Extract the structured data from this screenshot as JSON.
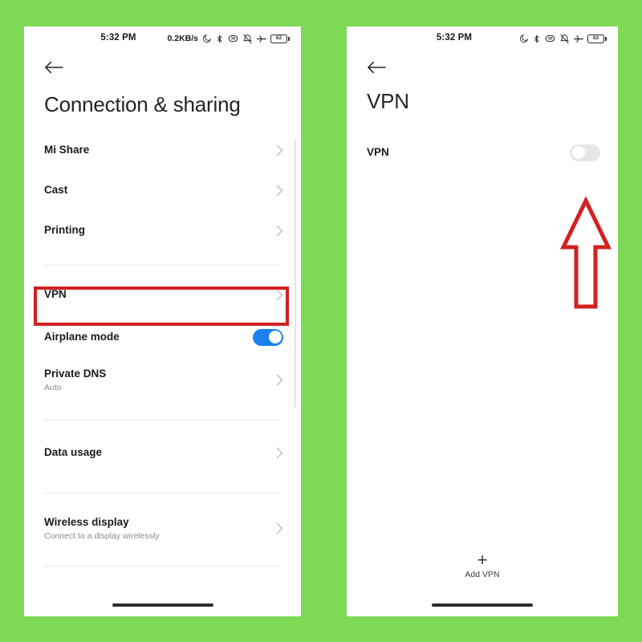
{
  "theme": {
    "background_color": "#7ed957",
    "accent_on_color": "#1a82f0",
    "annotation_color": "#d32020",
    "toggle_off_color": "#e6e6e6"
  },
  "left_phone": {
    "status_bar": {
      "time": "5:32 PM",
      "network_speed": "0.2KB/s",
      "icons": [
        "do-not-disturb-moon-icon",
        "bluetooth-icon",
        "vibrate-icon",
        "silent-icon",
        "airplane-mode-icon"
      ],
      "battery_level": "62"
    },
    "back_icon": "back-arrow-icon",
    "title": "Connection & sharing",
    "items": [
      {
        "label": "Mi Share",
        "subtitle": "",
        "control": "chevron"
      },
      {
        "label": "Cast",
        "subtitle": "",
        "control": "chevron"
      },
      {
        "label": "Printing",
        "subtitle": "",
        "control": "chevron"
      },
      {
        "label": "VPN",
        "subtitle": "",
        "control": "chevron",
        "highlighted": true
      },
      {
        "label": "Airplane mode",
        "subtitle": "",
        "control": "toggle",
        "toggle_state": "on"
      },
      {
        "label": "Private DNS",
        "subtitle": "Auto",
        "control": "chevron"
      },
      {
        "label": "Data usage",
        "subtitle": "",
        "control": "chevron"
      },
      {
        "label": "Wireless display",
        "subtitle": "Connect to a display wirelessly",
        "control": "chevron"
      }
    ]
  },
  "right_phone": {
    "status_bar": {
      "time": "5:32 PM",
      "network_speed": "",
      "icons": [
        "do-not-disturb-moon-icon",
        "bluetooth-icon",
        "vibrate-icon",
        "silent-icon",
        "airplane-mode-icon"
      ],
      "battery_level": "62"
    },
    "back_icon": "back-arrow-icon",
    "title": "VPN",
    "items": [
      {
        "label": "VPN",
        "subtitle": "",
        "control": "toggle",
        "toggle_state": "off"
      }
    ],
    "add_button": {
      "icon": "plus-icon",
      "label": "Add VPN"
    }
  },
  "annotations": {
    "highlight_target": "VPN",
    "arrow": "red-up-arrow-icon",
    "arrow_points_to": "vpn-toggle"
  }
}
